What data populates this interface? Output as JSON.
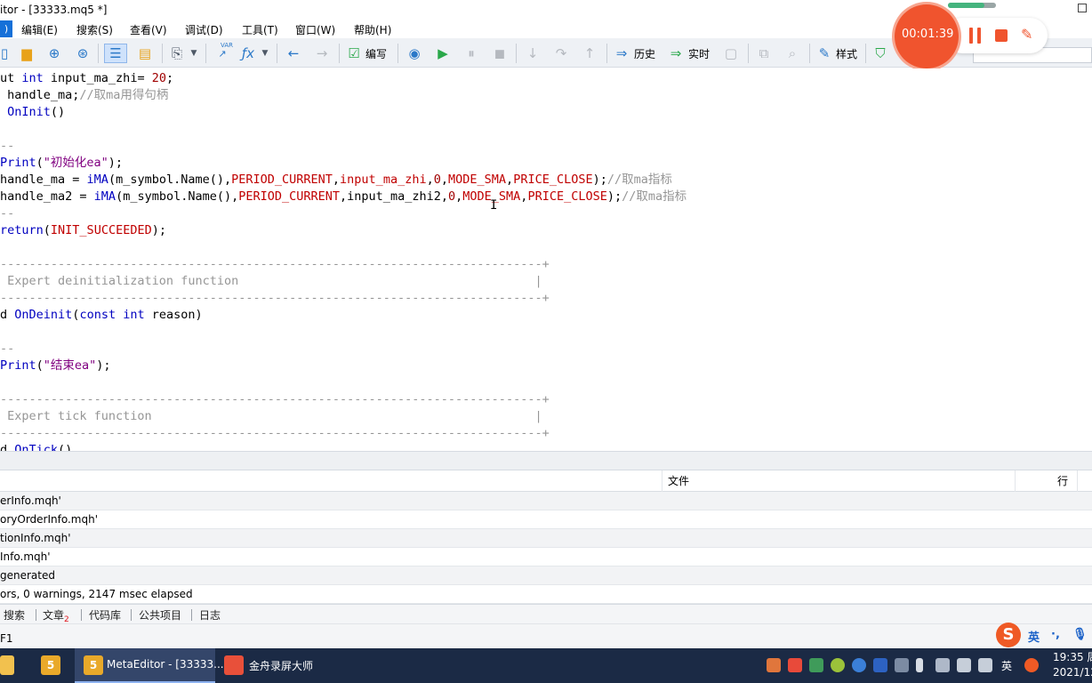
{
  "window": {
    "title": "itor - [33333.mq5 *]"
  },
  "menu": {
    "items": [
      "编辑(E)",
      "搜索(S)",
      "查看(V)",
      "调试(D)",
      "工具(T)",
      "窗口(W)",
      "帮助(H)"
    ]
  },
  "toolbar": {
    "compile_label": "编写",
    "history_label": "历史",
    "realtime_label": "实时",
    "style_label": "样式",
    "var_icon_text": "VAR"
  },
  "recorder": {
    "elapsed": "00:01:39",
    "progress_fraction": 0.75,
    "accent_color": "#f0542e"
  },
  "editor": {
    "lines": {
      "l1": {
        "a": "ut ",
        "b": "int",
        "c": " input_ma_zhi= ",
        "d": "20",
        "e": ";"
      },
      "l2": {
        "a": " handle_ma;",
        "b": "//取ma用得句柄"
      },
      "l3": {
        "a": " ",
        "b": "OnInit",
        "c": "()"
      },
      "l5": {
        "a": "--"
      },
      "l6": {
        "a": "Print",
        "b": "(",
        "c": "\"初始化ea\"",
        "d": ");"
      },
      "l7": {
        "a": "handle_ma = ",
        "b": "iMA",
        "c": "(m_symbol.Name(),",
        "d": "PERIOD_CURRENT",
        "e": ",",
        "f": "input_ma_zhi",
        "g": ",",
        "h": "0",
        "i": ",",
        "j": "MODE_SMA",
        "k": ",",
        "l": "PRICE_CLOSE",
        "m": ");",
        "n": "//取ma指标"
      },
      "l8": {
        "a": "handle_ma2 = ",
        "b": "iMA",
        "c": "(m_symbol.Name(),",
        "d": "PERIOD_CURRENT",
        "e": ",",
        "f": "input_ma_zhi2",
        "g": ",",
        "h": "0",
        "i": ",",
        "j": "MODE_SMA",
        "k": ",",
        "l": "PRICE_CLOSE",
        "m": ");",
        "n": "//取ma指标"
      },
      "l9": {
        "a": "--"
      },
      "l10": {
        "a": "return",
        "b": "(",
        "c": "INIT_SUCCEEDED",
        "d": ");"
      },
      "l12": {
        "a": "---------------------------------------------------------------------------+"
      },
      "l13": {
        "a": " Expert deinitialization function                                         |"
      },
      "l14": {
        "a": "---------------------------------------------------------------------------+"
      },
      "l15": {
        "a": "d ",
        "b": "OnDeinit",
        "c": "(",
        "d": "const",
        "e": " ",
        "f": "int",
        "g": " reason)"
      },
      "l17": {
        "a": "--"
      },
      "l18": {
        "a": "Print",
        "b": "(",
        "c": "\"结束ea\"",
        "d": ");"
      },
      "l20": {
        "a": "---------------------------------------------------------------------------+"
      },
      "l21": {
        "a": " Expert tick function                                                     |"
      },
      "l22": {
        "a": "---------------------------------------------------------------------------+"
      },
      "l23": {
        "a": "d ",
        "b": "OnTick",
        "c": "()"
      }
    }
  },
  "output": {
    "col_file": "文件",
    "col_line": "行",
    "rows": [
      "erInfo.mqh'",
      "oryOrderInfo.mqh'",
      "tionInfo.mqh'",
      "Info.mqh'",
      " generated",
      "ors, 0 warnings, 2147 msec elapsed"
    ]
  },
  "bottom_tabs": {
    "search": "搜索",
    "articles": "文章",
    "articles_badge": "2",
    "codebase": "代码库",
    "projects": "公共项目",
    "journal": "日志"
  },
  "status": {
    "help": "F1"
  },
  "ime": {
    "logo": "S",
    "lang": "英",
    "punct": "·,"
  },
  "taskbar": {
    "metaeditor_label": "MetaEditor - [33333...",
    "recorder_label": "金舟录屏大师",
    "tray_lang": "英",
    "clock_time": "19:35 周",
    "clock_date": "2021/12"
  },
  "colors": {
    "keyword": "#0000c0",
    "string": "#800080",
    "constant": "#c00000",
    "comment": "#969696",
    "taskbar": "#1b2a45"
  }
}
